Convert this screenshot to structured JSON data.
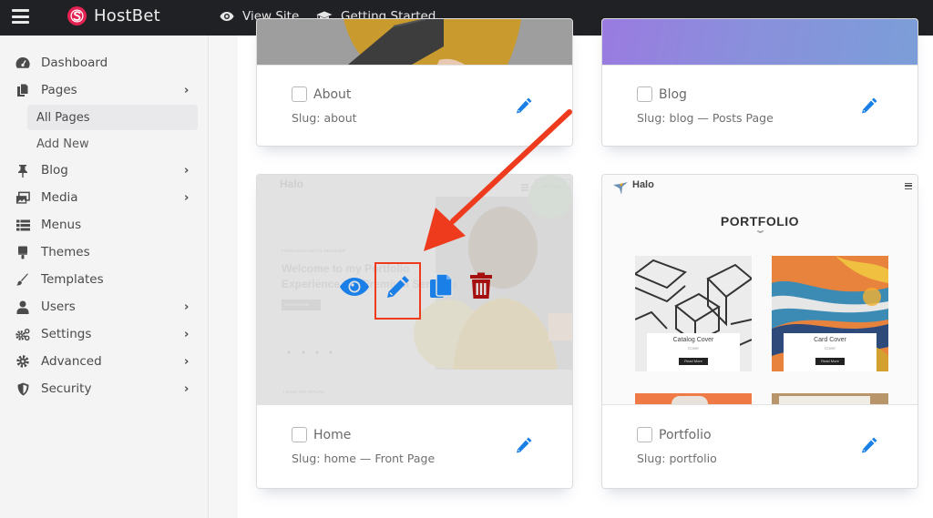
{
  "topbar": {
    "menu_icon": "hamburger-icon",
    "brand": "HostBet",
    "brand_color": "#e32352",
    "links": [
      {
        "label": "View Site",
        "icon": "eye-icon"
      },
      {
        "label": "Getting Started",
        "icon": "graduation-cap-icon"
      }
    ]
  },
  "sidebar": {
    "items": [
      {
        "label": "Dashboard",
        "icon": "dashboard-icon",
        "has_children": false
      },
      {
        "label": "Pages",
        "icon": "pages-icon",
        "has_children": true,
        "expanded": true,
        "children": [
          {
            "label": "All Pages",
            "active": true
          },
          {
            "label": "Add New",
            "active": false
          }
        ]
      },
      {
        "label": "Blog",
        "icon": "pin-icon",
        "has_children": true
      },
      {
        "label": "Media",
        "icon": "media-icon",
        "has_children": true
      },
      {
        "label": "Menus",
        "icon": "list-icon",
        "has_children": false
      },
      {
        "label": "Themes",
        "icon": "paint-roller-icon",
        "has_children": false
      },
      {
        "label": "Templates",
        "icon": "brush-icon",
        "has_children": false
      },
      {
        "label": "Users",
        "icon": "user-icon",
        "has_children": true
      },
      {
        "label": "Settings",
        "icon": "cogs-icon",
        "has_children": true
      },
      {
        "label": "Advanced",
        "icon": "cog-icon",
        "has_children": true
      },
      {
        "label": "Security",
        "icon": "shield-icon",
        "has_children": true
      }
    ],
    "chevron": "›"
  },
  "pages": [
    {
      "title": "About",
      "slug": "Slug: about",
      "checked": false
    },
    {
      "title": "Blog",
      "slug": "Slug: blog — Posts Page",
      "checked": false
    },
    {
      "title": "Home",
      "slug": "Slug: home — Front Page",
      "checked": false,
      "hovered": true,
      "preview": {
        "logo": "Halo",
        "kicker": "FREELANCE DIGITAL DESIGNER",
        "heading_line1": "Welcome to my Portfolio",
        "heading_line2": "Experience the Premium Services",
        "button": "LEARN MORE",
        "cta": "LET'S TALK",
        "section": "I MAKE THE FUTURE"
      },
      "actions": [
        {
          "name": "view",
          "icon": "eye-icon",
          "color": "#1a7fe6"
        },
        {
          "name": "edit",
          "icon": "pencil-icon",
          "color": "#1a7fe6",
          "highlighted": true
        },
        {
          "name": "duplicate",
          "icon": "copy-icon",
          "color": "#1a7fe6"
        },
        {
          "name": "delete",
          "icon": "trash-icon",
          "color": "#a50f0f"
        }
      ]
    },
    {
      "title": "Portfolio",
      "slug": "Slug: portfolio",
      "checked": false,
      "preview": {
        "logo": "Halo",
        "heading": "PORTFOLIO",
        "items": [
          {
            "title": "Catalog Cover",
            "subtitle": "Cover",
            "button": "Read More"
          },
          {
            "title": "Card Cover",
            "subtitle": "Cover",
            "button": "Read More"
          }
        ]
      }
    }
  ],
  "annotation": {
    "arrow_color": "#ee3b1e",
    "box_color": "#ee3b1e"
  },
  "accent": "#1a7fe6"
}
